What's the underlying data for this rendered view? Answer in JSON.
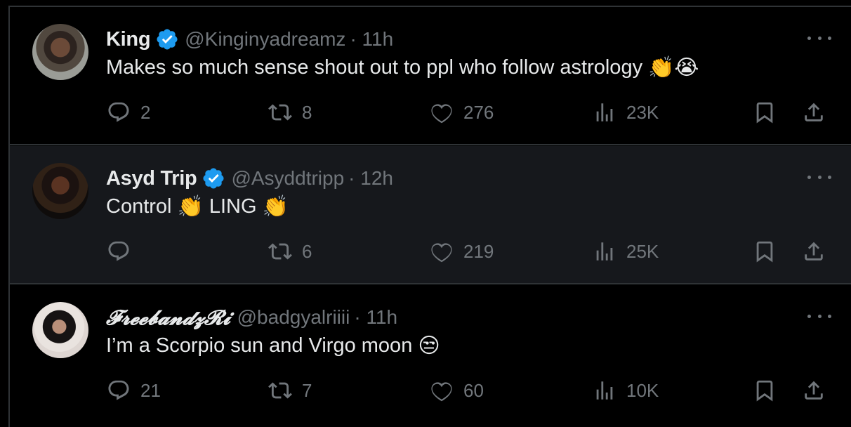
{
  "colors": {
    "background": "#000000",
    "highlight_row": "#16181c",
    "divider": "#2f3336",
    "primary_text": "#e7e9ea",
    "secondary_text": "#71767b",
    "verified_blue": "#1d9bf0"
  },
  "tweets": [
    {
      "name": "King",
      "verified": true,
      "handle": "@Kinginyadreamz",
      "time": "· 11h",
      "text": "Makes so much sense shout out to ppl who follow astrology",
      "emojis": "👏😭",
      "replies": "2",
      "retweets": "8",
      "likes": "276",
      "views": "23K"
    },
    {
      "name": "Asyd Trip",
      "verified": true,
      "handle": "@Asyddtripp",
      "time": "· 12h",
      "text_parts": [
        "Control",
        "LING"
      ],
      "emoji": "👏",
      "replies": "",
      "retweets": "6",
      "likes": "219",
      "views": "25K"
    },
    {
      "name": "𝓕𝓻𝓮𝓮𝓫𝓪𝓷𝓭𝔃𝓡𝓲",
      "verified": false,
      "handle": "@badgyalriiii",
      "time": "· 11h",
      "text": "I’m a Scorpio sun and Virgo moon",
      "emojis": "😒",
      "replies": "21",
      "retweets": "7",
      "likes": "60",
      "views": "10K"
    }
  ]
}
